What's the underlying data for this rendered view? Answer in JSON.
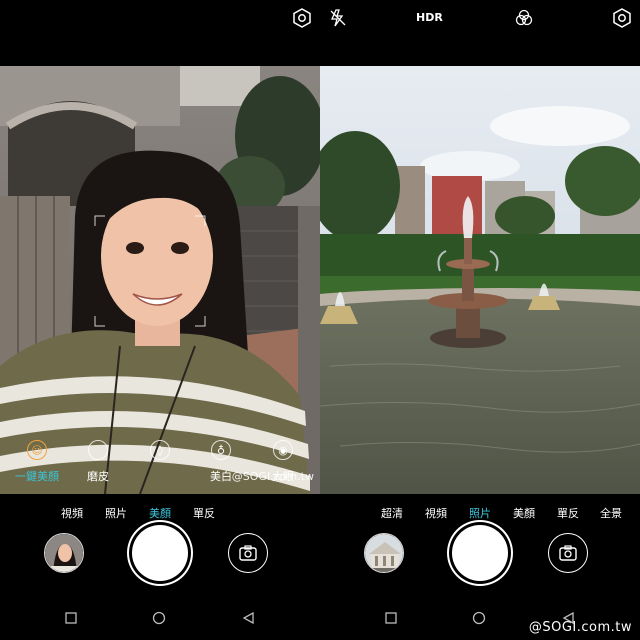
{
  "left_screen": {
    "top_icons": [
      {
        "name": "settings-icon"
      }
    ],
    "beauty_options": [
      {
        "label": "一鍵美顏",
        "icon": "face-icon",
        "active": true
      },
      {
        "label": "磨皮",
        "icon": "circle-icon",
        "active": false
      },
      {
        "label": "",
        "icon": "leaf-icon",
        "active": false
      },
      {
        "label": "美白",
        "icon": "flask-icon",
        "active": false
      },
      {
        "label": "大眼",
        "icon": "eye-icon",
        "active": false
      }
    ],
    "watermark": "@SOGI.com.tw",
    "modes": [
      {
        "label": "視頻",
        "active": false
      },
      {
        "label": "照片",
        "active": false
      },
      {
        "label": "美顏",
        "active": true
      },
      {
        "label": "單反",
        "active": false
      }
    ]
  },
  "right_screen": {
    "top_icons": [
      {
        "name": "flash-off-icon"
      },
      {
        "name": "hdr-icon",
        "text": "HDR"
      },
      {
        "name": "filter-icon"
      },
      {
        "name": "settings-icon"
      }
    ],
    "modes": [
      {
        "label": "超清",
        "active": false
      },
      {
        "label": "視頻",
        "active": false
      },
      {
        "label": "照片",
        "active": true
      },
      {
        "label": "美顏",
        "active": false
      },
      {
        "label": "單反",
        "active": false
      },
      {
        "label": "全景",
        "active": false
      }
    ],
    "site_mark": "@SOGI.com.tw"
  },
  "colors": {
    "active_mode": "#3ec6dc",
    "active_beauty_ring": "#f3a340",
    "background": "#000000"
  }
}
